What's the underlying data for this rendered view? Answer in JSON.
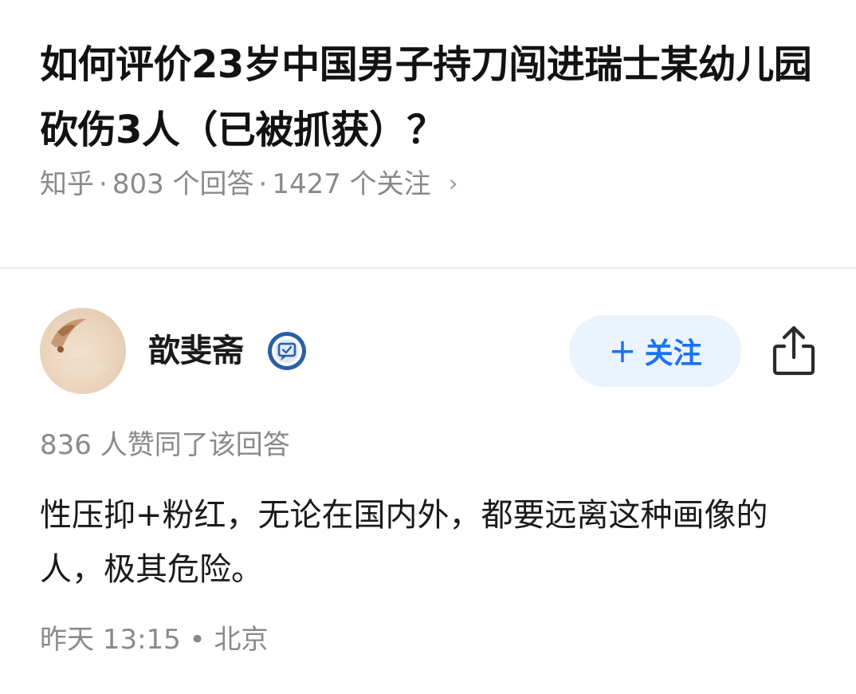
{
  "question": {
    "title": "如何评价23岁中国男子持刀闯进瑞士某幼儿园砍伤3人（已被抓获）？",
    "source": "知乎",
    "answers": "803 个回答",
    "followers": "1427 个关注",
    "separator": "·",
    "chevron": "›"
  },
  "author": {
    "name": "歆斐斋",
    "avatar_icon": "avatar-image",
    "badge_icon": "verified-badge-icon",
    "follow_label": "关注",
    "follow_plus": "+",
    "share_icon": "share-icon",
    "accent_color": "#1772f6"
  },
  "answer": {
    "likes": "836 人赞同了该回答",
    "content": "性压抑+粉红，无论在国内外，都要远离这种画像的人，极其危险。",
    "time": "昨天 13:15",
    "dot": "•",
    "location": "北京"
  }
}
